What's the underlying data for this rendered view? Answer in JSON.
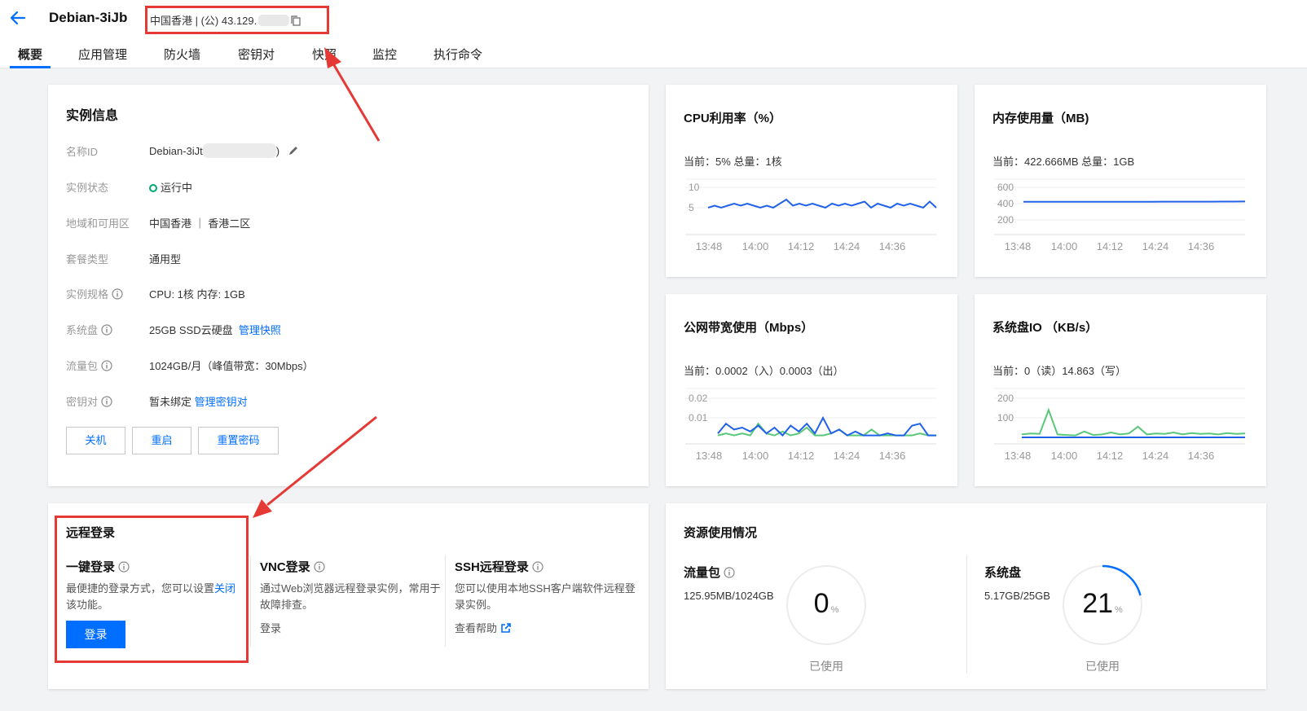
{
  "header": {
    "title": "Debian-3iJb",
    "ip_text": "中国香港 | (公) 43.129.",
    "tabs": [
      "概要",
      "应用管理",
      "防火墙",
      "密钥对",
      "快照",
      "监控",
      "执行命令"
    ]
  },
  "instance": {
    "title": "实例信息",
    "rows": [
      {
        "label": "名称ID",
        "value": "Debian-3iJt",
        "suffix": ")"
      },
      {
        "label": "实例状态",
        "value": "运行中"
      },
      {
        "label": "地域和可用区",
        "value": "中国香港 ｜ 香港二区"
      },
      {
        "label": "套餐类型",
        "value": "通用型"
      },
      {
        "label": "实例规格",
        "value": "CPU: 1核 内存: 1GB"
      },
      {
        "label": "系统盘",
        "value": "25GB SSD云硬盘",
        "link": "管理快照"
      },
      {
        "label": "流量包",
        "value": "1024GB/月（峰值带宽：30Mbps）"
      },
      {
        "label": "密钥对",
        "value": "暂未绑定",
        "link": "管理密钥对"
      }
    ],
    "buttons": [
      "关机",
      "重启",
      "重置密码"
    ]
  },
  "metrics": {
    "cpu": {
      "title": "CPU利用率（%）",
      "current": "当前：5% 总量：1核"
    },
    "mem": {
      "title": "内存使用量（MB)",
      "current": "当前：422.666MB 总量：1GB"
    },
    "net": {
      "title": "公网带宽使用（Mbps）",
      "current": "当前：0.0002（入）0.0003（出）"
    },
    "disk": {
      "title": "系统盘IO （KB/s）",
      "current": "当前：0（读）14.863（写）"
    },
    "x_ticks": [
      "13:48",
      "14:00",
      "14:12",
      "14:24",
      "14:36"
    ],
    "cpu_y": [
      "10",
      "5"
    ],
    "mem_y": [
      "600",
      "400",
      "200"
    ],
    "net_y": [
      "0.02",
      "0.01"
    ],
    "disk_y": [
      "200",
      "100"
    ]
  },
  "chart_data": [
    {
      "type": "line",
      "title": "CPU利用率（%）",
      "x": [
        "13:48",
        "14:00",
        "14:12",
        "14:24",
        "14:36"
      ],
      "ylim": [
        0,
        12
      ],
      "series": [
        {
          "values": [
            5,
            5.5,
            5,
            5.5,
            6,
            5.5,
            6,
            5.5,
            5,
            5.5,
            5,
            6,
            7,
            5.5,
            6,
            5.5,
            6,
            5.5,
            5,
            6,
            5.5,
            6,
            5.5,
            6,
            6.5,
            5,
            6,
            5.5,
            5,
            6,
            5.5,
            6,
            5.5,
            5,
            6.5,
            5
          ]
        }
      ]
    },
    {
      "type": "line",
      "title": "内存使用量（MB)",
      "x": [
        "13:48",
        "14:00",
        "14:12",
        "14:24",
        "14:36"
      ],
      "ylim": [
        100,
        700
      ],
      "series": [
        {
          "values": [
            422,
            422,
            422,
            422,
            422,
            422,
            423,
            423,
            423,
            423,
            423,
            423,
            424,
            424,
            424,
            424,
            424,
            425,
            425,
            426
          ]
        }
      ]
    },
    {
      "type": "line",
      "title": "公网带宽使用（Mbps）",
      "x": [
        "13:48",
        "14:00",
        "14:12",
        "14:24",
        "14:36"
      ],
      "ylim": [
        0,
        0.025
      ],
      "series": [
        {
          "name": "入",
          "values": [
            0.001,
            0.002,
            0.001,
            0.002,
            0.001,
            0.007,
            0.002,
            0.001,
            0.003,
            0.001,
            0.002,
            0.005,
            0.001,
            0.001,
            0.002,
            0.004,
            0.001,
            0.001,
            0.001,
            0.004,
            0.001,
            0.001,
            0.001,
            0.001,
            0.001,
            0.002,
            0.001,
            0.001
          ]
        },
        {
          "name": "出",
          "values": [
            0.002,
            0.007,
            0.004,
            0.005,
            0.003,
            0.006,
            0.002,
            0.005,
            0.001,
            0.006,
            0.003,
            0.007,
            0.002,
            0.01,
            0.002,
            0.004,
            0.001,
            0.003,
            0.001,
            0.001,
            0.001,
            0.002,
            0.001,
            0.001,
            0.006,
            0.007,
            0.001,
            0.001
          ]
        }
      ]
    },
    {
      "type": "line",
      "title": "系统盘IO （KB/s）",
      "x": [
        "13:48",
        "14:00",
        "14:12",
        "14:24",
        "14:36"
      ],
      "ylim": [
        0,
        250
      ],
      "series": [
        {
          "name": "读",
          "values": [
            0,
            0,
            0,
            0,
            0,
            0,
            0,
            0,
            0,
            0,
            0,
            0,
            0,
            0,
            0,
            0,
            0,
            0,
            0,
            0,
            0,
            0,
            0,
            0,
            0,
            0
          ]
        },
        {
          "name": "写",
          "values": [
            15,
            20,
            18,
            140,
            15,
            12,
            10,
            30,
            12,
            15,
            25,
            15,
            20,
            55,
            15,
            20,
            18,
            25,
            15,
            22,
            18,
            20,
            15,
            22,
            18,
            20
          ]
        }
      ]
    }
  ],
  "remote": {
    "title": "远程登录",
    "oneclick": {
      "title": "一键登录",
      "desc": "最便捷的登录方式，您可以设置",
      "link": "关闭",
      "desc2": "该功能。",
      "button": "登录"
    },
    "vnc": {
      "title": "VNC登录",
      "desc": "通过Web浏览器远程登录实例，常用于故障排查。",
      "link": "登录"
    },
    "ssh": {
      "title": "SSH远程登录",
      "desc": "您可以使用本地SSH客户端软件远程登录实例。",
      "link": "查看帮助"
    }
  },
  "resources": {
    "title": "资源使用情况",
    "traffic": {
      "label": "流量包",
      "value": "125.95MB/1024GB",
      "percent": "0",
      "unit": "%",
      "used": "已使用"
    },
    "disk": {
      "label": "系统盘",
      "value": "5.17GB/25GB",
      "percent": "21",
      "unit": "%",
      "used": "已使用"
    }
  },
  "colors": {
    "accent": "#006eff",
    "highlight": "#e53935",
    "green": "#00a870",
    "series_in": "#5ac77a",
    "series_out": "#2162e8"
  }
}
